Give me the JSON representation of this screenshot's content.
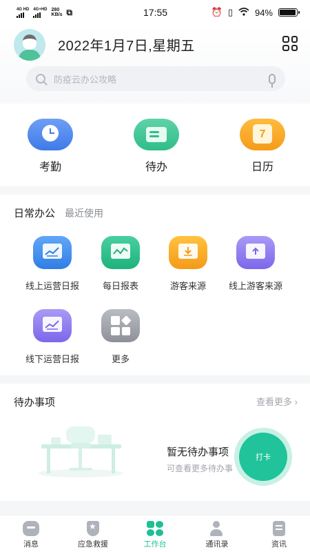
{
  "status_bar": {
    "network1": "4G HD",
    "network2": "4G+HD",
    "speed": "280",
    "speed_unit": "KB/s",
    "time": "17:55",
    "battery": "94%",
    "battery_level": 0.94
  },
  "header": {
    "date_title": "2022年1月7日,星期五",
    "search_placeholder": "防疫云办公攻略"
  },
  "quick_actions": [
    {
      "label": "考勤",
      "icon": "clock-icon"
    },
    {
      "label": "待办",
      "icon": "todo-card-icon"
    },
    {
      "label": "日历",
      "icon": "calendar-icon",
      "icon_text": "7"
    }
  ],
  "daily": {
    "tab_active": "日常办公",
    "tab_recent": "最近使用",
    "apps": [
      {
        "label": "线上运营日报",
        "icon": "chart-icon"
      },
      {
        "label": "每日报表",
        "icon": "line-chart-icon"
      },
      {
        "label": "游客来源",
        "icon": "download-icon"
      },
      {
        "label": "线上游客来源",
        "icon": "upload-icon"
      },
      {
        "label": "线下运营日报",
        "icon": "chart-icon"
      },
      {
        "label": "更多",
        "icon": "more-tiles-icon"
      }
    ]
  },
  "todo": {
    "title": "待办事项",
    "more": "查看更多",
    "empty_title": "暂无待办事项",
    "empty_sub": "可查看更多待办事",
    "punch_label": "打卡"
  },
  "tabbar": [
    {
      "label": "消息",
      "icon": "message-icon",
      "active": false
    },
    {
      "label": "应急救援",
      "icon": "star-shield-icon",
      "active": false
    },
    {
      "label": "工作台",
      "icon": "workbench-icon",
      "active": true
    },
    {
      "label": "通讯录",
      "icon": "contacts-icon",
      "active": false
    },
    {
      "label": "资讯",
      "icon": "news-icon",
      "active": false
    }
  ],
  "colors": {
    "accent": "#1fbf96",
    "blue": "#3f7ae8",
    "orange": "#f59b1b",
    "purple": "#7c67ea"
  }
}
